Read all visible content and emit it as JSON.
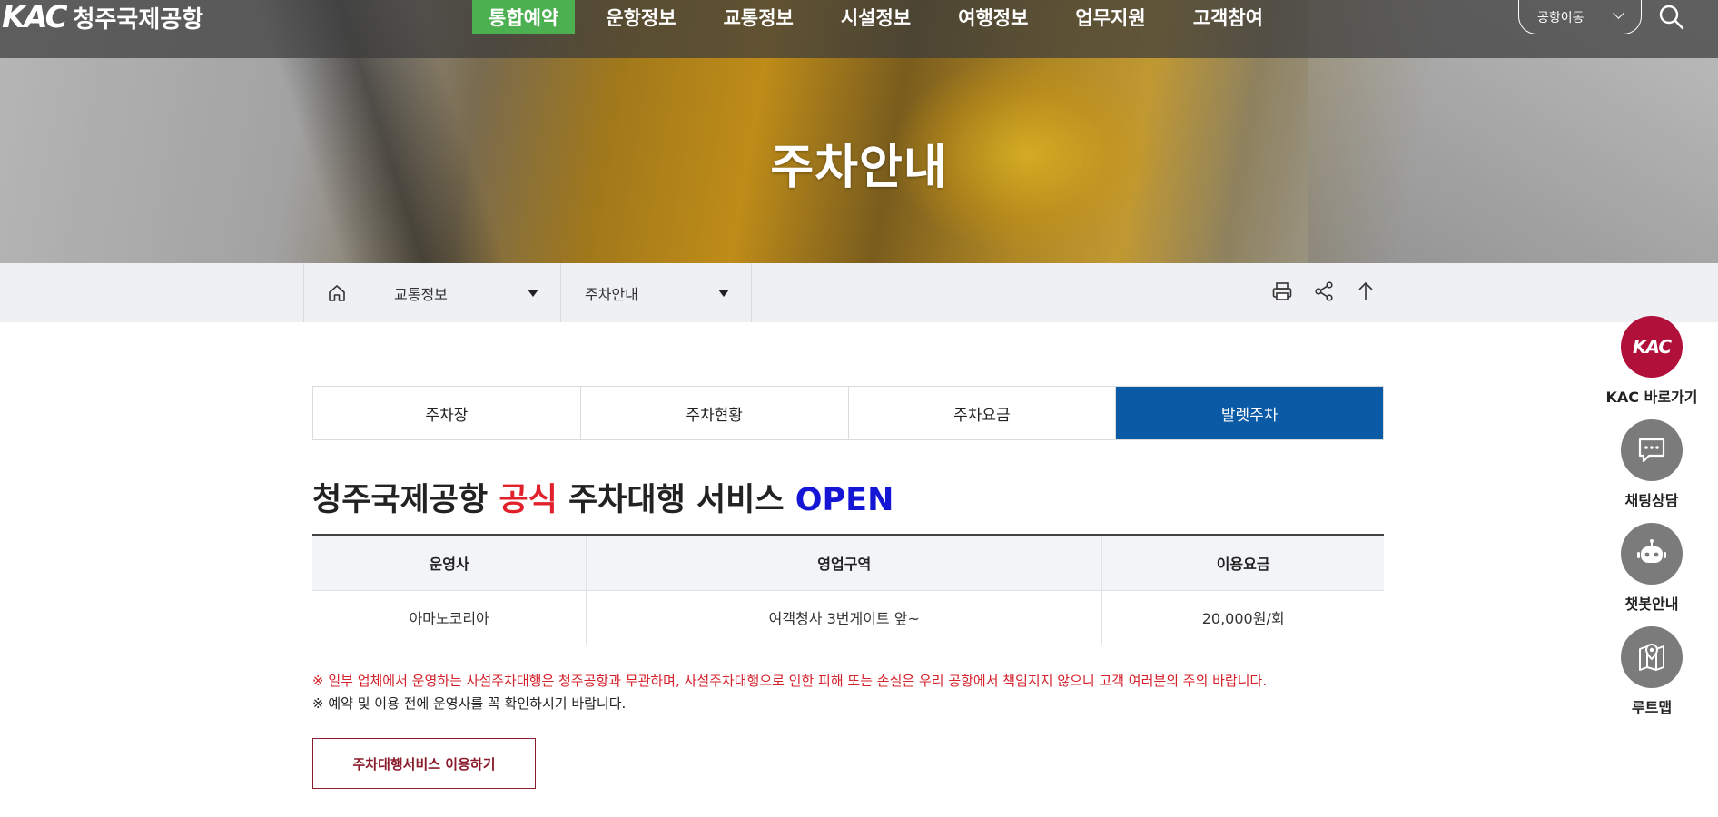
{
  "header": {
    "logo_mark": "KAC",
    "logo_text": "청주국제공항",
    "nav": [
      {
        "label": "통합예약",
        "active": true
      },
      {
        "label": "운항정보",
        "active": false
      },
      {
        "label": "교통정보",
        "active": false
      },
      {
        "label": "시설정보",
        "active": false
      },
      {
        "label": "여행정보",
        "active": false
      },
      {
        "label": "업무지원",
        "active": false
      },
      {
        "label": "고객참여",
        "active": false
      }
    ],
    "airport_select": "공항이동",
    "accent_color": "#4caf50"
  },
  "hero": {
    "title": "주차안내"
  },
  "location": {
    "depth1": "교통정보",
    "depth2": "주차안내"
  },
  "tabs": [
    {
      "label": "주차장",
      "active": false
    },
    {
      "label": "주차현황",
      "active": false
    },
    {
      "label": "주차요금",
      "active": false
    },
    {
      "label": "발렛주차",
      "active": true
    }
  ],
  "headline": {
    "part1": "청주국제공항 ",
    "red": "공식",
    "part2": " 주차대행 서비스 ",
    "blue": "OPEN"
  },
  "table": {
    "headers": [
      "운영사",
      "영업구역",
      "이용요금"
    ],
    "rows": [
      [
        "아마노코리아",
        "여객청사 3번게이트 앞~",
        "20,000원/회"
      ]
    ]
  },
  "notes": {
    "warning": "※ 일부 업체에서 운영하는 사설주차대행은 청주공항과 무관하며, 사설주차대행으로 인한 피해 또는 손실은 우리 공항에서 책임지지 않으니 고객 여러분의 주의 바랍니다.",
    "info": "※ 예약 및 이용 전에 운영사를 꼭 확인하시기 바랍니다."
  },
  "cta_label": "주차대행서비스 이용하기",
  "quick_menu": [
    {
      "label": "KAC 바로가기",
      "icon": "kac-logo-icon",
      "mark": "KAC"
    },
    {
      "label": "채팅상담",
      "icon": "chat-icon"
    },
    {
      "label": "챗봇안내",
      "icon": "robot-icon"
    },
    {
      "label": "루트맵",
      "icon": "map-icon"
    }
  ]
}
